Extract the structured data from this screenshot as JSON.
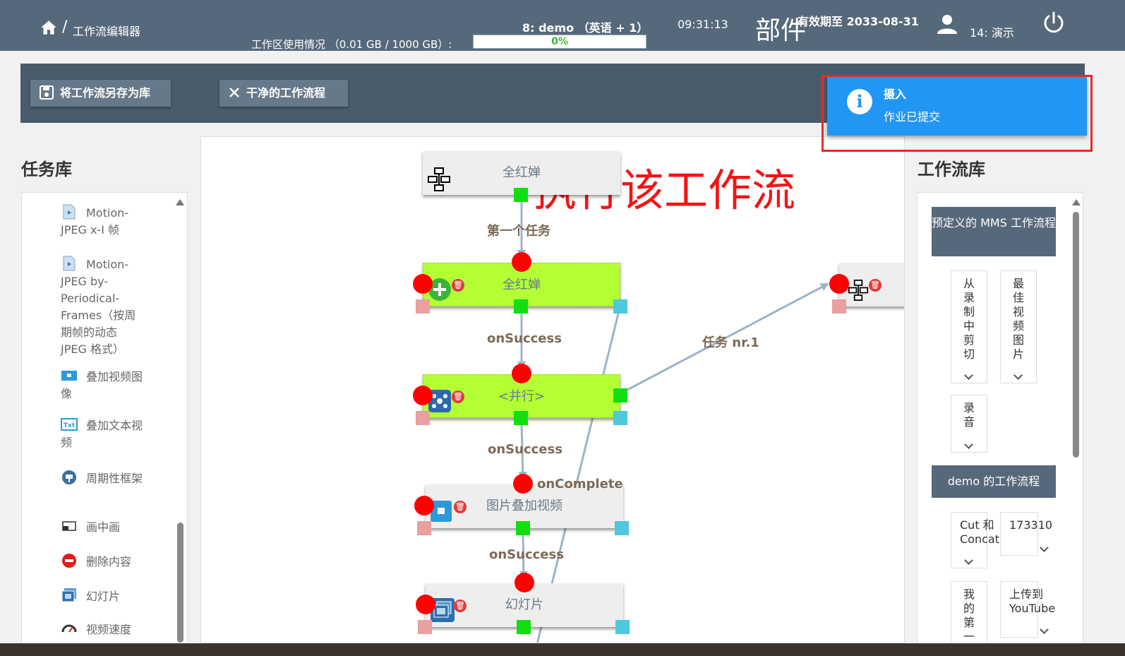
{
  "header": {
    "breadcrumb_sep": "/",
    "breadcrumb": "工作流编辑器",
    "usage_label": "工作区使用情况 （0.01 GB / 1000 GB）:",
    "usage_percent_text": "0%",
    "usage_fraction": 0.0,
    "workspace": "8:  demo （英语 + 1）",
    "time": "09:31:13",
    "bujian": "部件",
    "expiry": "有效期至 2033-08-31",
    "user": "14:  演示"
  },
  "toolbar": {
    "save_label": "将工作流另存为库",
    "clean_label": "干净的工作流程"
  },
  "left": {
    "title": "任务库",
    "items": [
      {
        "label": "Motion-JPEG x-I 帧",
        "icon": "file-video-icon"
      },
      {
        "label": "Motion-JPEG by-Periodical-Frames（按周期帧的动态 JPEG 格式）",
        "icon": "file-video-icon"
      },
      {
        "label": "叠加视频图像",
        "icon": "overlay-image-icon"
      },
      {
        "label": "叠加文本视频",
        "icon": "overlay-text-icon"
      },
      {
        "label": "周期性框架",
        "icon": "periodic-frame-icon"
      },
      {
        "label": "画中画",
        "icon": "pip-icon"
      },
      {
        "label": "删除内容",
        "icon": "remove-content-icon"
      },
      {
        "label": "幻灯片",
        "icon": "slideshow-icon"
      },
      {
        "label": "视频速度",
        "icon": "video-speed-icon"
      }
    ]
  },
  "canvas": {
    "exec_label": "执行该工作流",
    "nodes": {
      "root": "全红婵",
      "task1": "全红婵",
      "parallel": "<并行>",
      "overlay": "图片叠加视频",
      "slideshow": "幻灯片",
      "side": ""
    },
    "links": {
      "first": "第一个任务",
      "success1": "onSuccess",
      "success2": "onSuccess",
      "complete": "onComplete",
      "success3": "onSuccess",
      "task_nr1": "任务 nr.1"
    }
  },
  "right": {
    "title": "工作流库",
    "group1": "预定义的 MMS 工作流程",
    "cards1": [
      "从录制中剪切",
      "最佳视频图片",
      "录音"
    ],
    "group2": "demo 的工作流程",
    "cards2": [
      "Cut 和 Concat",
      "173310",
      "我的第一",
      "上传到 YouTube"
    ]
  },
  "notification": {
    "title": "摄入",
    "message": "作业已提交"
  },
  "colors": {
    "header": "#56697a",
    "toolbar": "#4a5c6b",
    "node_lime": "#b3ff34",
    "notification": "#2196f3",
    "highlight": "#e82b2b",
    "exec_label": "#f21515"
  }
}
